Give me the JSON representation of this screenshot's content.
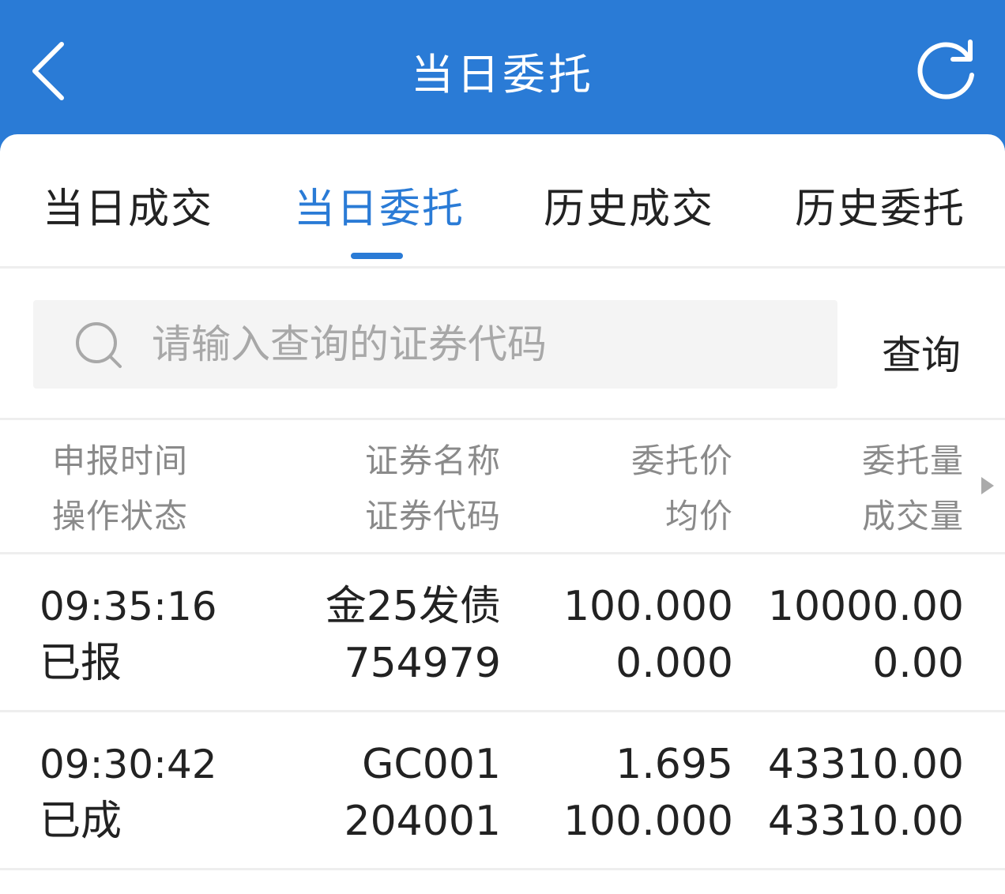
{
  "header": {
    "title": "当日委托",
    "back_icon": "chevron-left-icon",
    "refresh_icon": "refresh-icon"
  },
  "tabs": [
    {
      "label": "当日成交",
      "active": false
    },
    {
      "label": "当日委托",
      "active": true
    },
    {
      "label": "历史成交",
      "active": false
    },
    {
      "label": "历史委托",
      "active": false
    }
  ],
  "search": {
    "placeholder": "请输入查询的证券代码",
    "value": "",
    "button_label": "查询",
    "icon": "search-icon"
  },
  "columns": [
    {
      "line1": "申报时间",
      "line2": "操作状态"
    },
    {
      "line1": "证券名称",
      "line2": "证券代码"
    },
    {
      "line1": "委托价",
      "line2": "均价"
    },
    {
      "line1": "委托量",
      "line2": "成交量"
    }
  ],
  "rows": [
    {
      "time": "09:35:16",
      "status": "已报",
      "name": "金25发债",
      "code": "754979",
      "price": "100.000",
      "avg_price": "0.000",
      "qty": "10000.00",
      "filled_qty": "0.00"
    },
    {
      "time": "09:30:42",
      "status": "已成",
      "name": "GC001",
      "code": "204001",
      "price": "1.695",
      "avg_price": "100.000",
      "qty": "43310.00",
      "filled_qty": "43310.00"
    }
  ],
  "colors": {
    "brand_blue": "#2a7bd6",
    "text_dark": "#222222",
    "text_gray": "#8a8a8a",
    "placeholder_gray": "#a8a8a8"
  }
}
